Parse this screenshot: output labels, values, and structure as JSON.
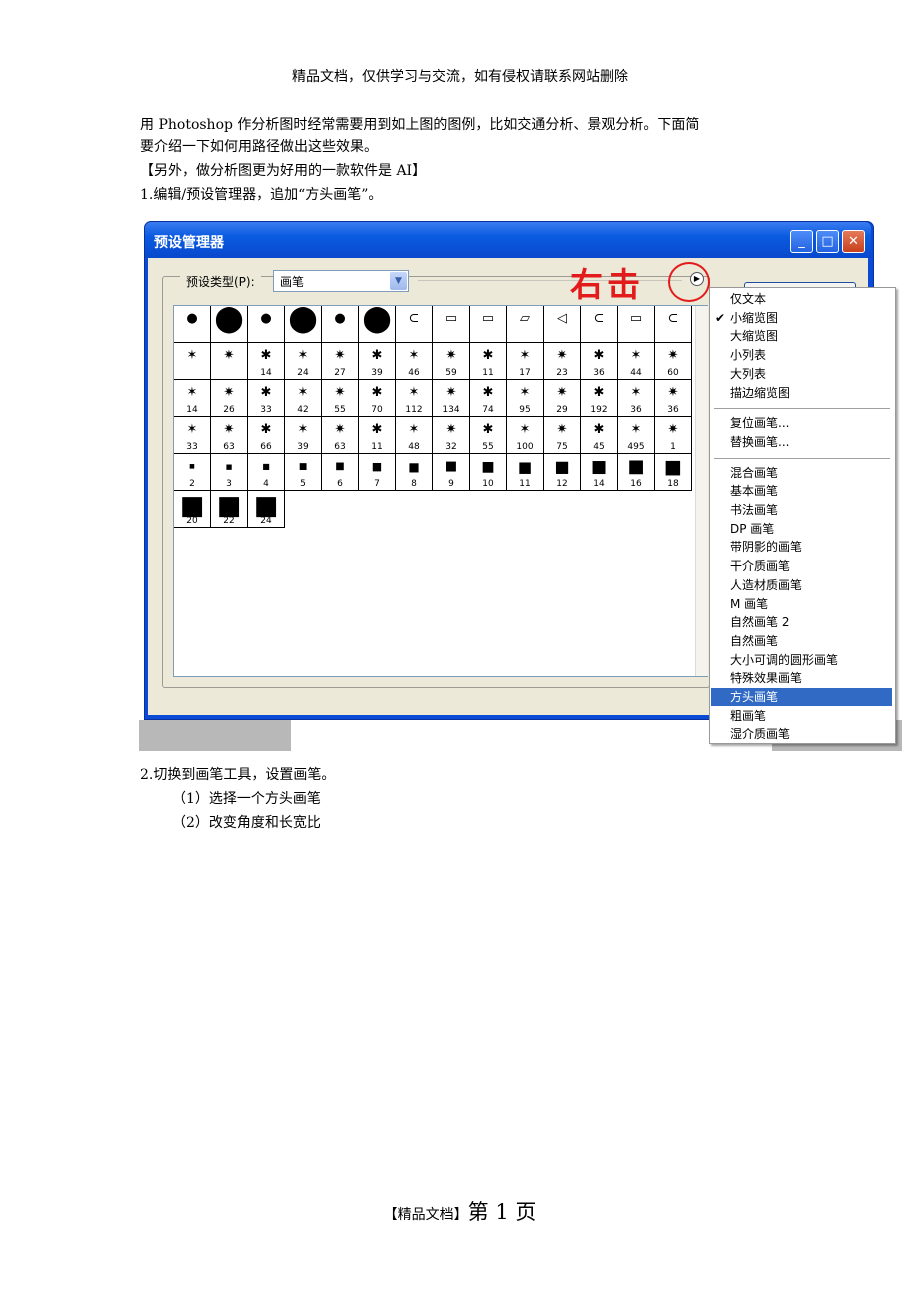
{
  "header": "精品文档，仅供学习与交流，如有侵权请联系网站删除",
  "intro": {
    "line1": "用 Photoshop 作分析图时经常需要用到如上图的图例，比如交通分析、景观分析。下面简",
    "line2": "要介绍一下如何用路径做出这些效果。",
    "line3": "【另外，做分析图更为好用的一款软件是 AI】",
    "line4": "1.编辑/预设管理器，追加“方头画笔”。"
  },
  "dialog": {
    "title": "预设管理器",
    "type_label": "预设类型(P):",
    "type_value": "画笔",
    "annotation": "右击",
    "brush_numbers": [
      [
        "",
        "",
        "",
        "",
        "",
        "",
        "",
        "",
        "",
        "",
        "",
        "",
        "",
        ""
      ],
      [
        "",
        "",
        "14",
        "24",
        "27",
        "39",
        "46",
        "59",
        "11",
        "17",
        "23",
        "36",
        "44",
        "60"
      ],
      [
        "14",
        "26",
        "33",
        "42",
        "55",
        "70",
        "112",
        "134",
        "74",
        "95",
        "29",
        "192",
        "36",
        "36"
      ],
      [
        "33",
        "63",
        "66",
        "39",
        "63",
        "11",
        "48",
        "32",
        "55",
        "100",
        "75",
        "45",
        "495",
        "1"
      ],
      [
        "2",
        "3",
        "4",
        "5",
        "6",
        "7",
        "8",
        "9",
        "10",
        "11",
        "12",
        "14",
        "16",
        "18"
      ],
      [
        "20",
        "22",
        "24"
      ]
    ]
  },
  "menu": {
    "group1": [
      "仅文本",
      "小缩览图",
      "大缩览图",
      "小列表",
      "大列表",
      "描边缩览图"
    ],
    "checked": "小缩览图",
    "group2": [
      "复位画笔...",
      "替换画笔..."
    ],
    "group3": [
      "混合画笔",
      "基本画笔",
      "书法画笔",
      "DP 画笔",
      "带阴影的画笔",
      "干介质画笔",
      "人造材质画笔",
      "M 画笔",
      "自然画笔 2",
      "自然画笔",
      "大小可调的圆形画笔",
      "特殊效果画笔",
      "方头画笔",
      "粗画笔",
      "湿介质画笔"
    ],
    "selected": "方头画笔"
  },
  "steps": {
    "step2": "2.切换到画笔工具，设置画笔。",
    "sub1": "（1）选择一个方头画笔",
    "sub2": "（2）改变角度和长宽比"
  },
  "footer": {
    "label": "【精品文档】",
    "page": "第 1 页"
  }
}
